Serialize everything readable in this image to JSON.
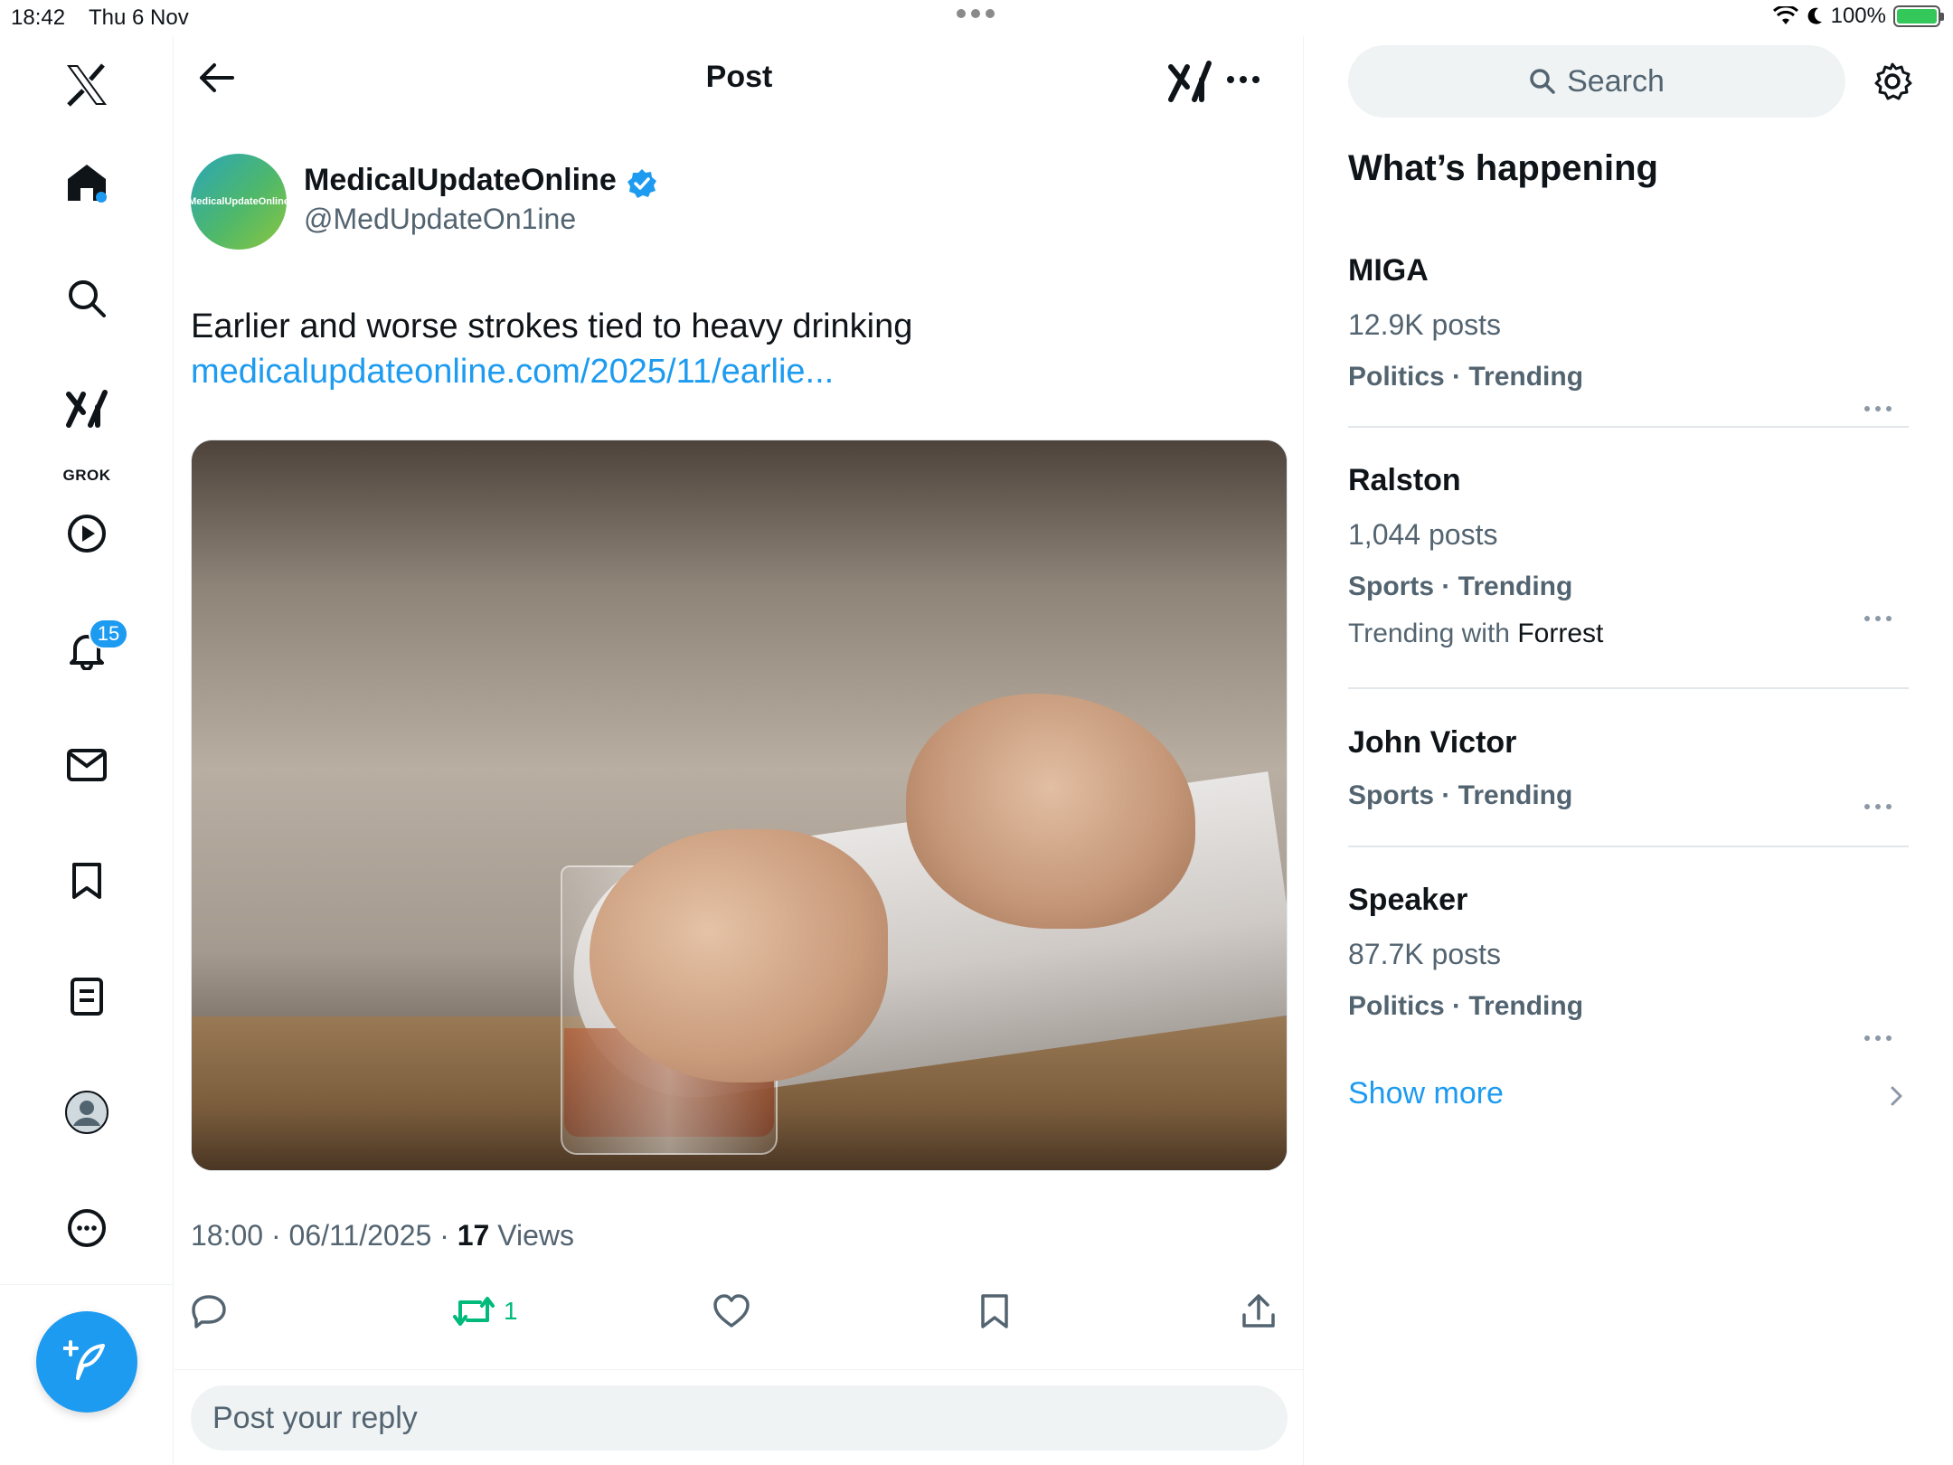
{
  "status_bar": {
    "time": "18:42",
    "date": "Thu 6 Nov",
    "battery": "100%"
  },
  "nav": {
    "notifications_badge": "15",
    "grok_label": "GROK"
  },
  "header": {
    "title": "Post"
  },
  "post": {
    "author_name": "MedicalUpdateOnline",
    "author_handle": "@MedUpdateOn1ine",
    "avatar_text": "MedicalUpdateOnline",
    "text": "Earlier and worse strokes tied to heavy drinking",
    "link": "medicalupdateonline.com/2025/11/earlie...",
    "time": "18:00",
    "date": "06/11/2025",
    "views_count": "17",
    "views_label": "Views",
    "retweet_count": "1"
  },
  "reply": {
    "placeholder": "Post your reply"
  },
  "sidebar": {
    "search_placeholder": "Search",
    "section_title": "What’s happening",
    "trends": [
      {
        "name": "MIGA",
        "count": "12.9K posts",
        "category": "Politics · Trending"
      },
      {
        "name": "Ralston",
        "count": "1,044 posts",
        "category": "Sports · Trending",
        "with_label": "Trending with",
        "with_name": "Forrest"
      },
      {
        "name": "John Victor",
        "category": "Sports · Trending"
      },
      {
        "name": "Speaker",
        "count": "87.7K posts",
        "category": "Politics · Trending"
      }
    ],
    "show_more": "Show more"
  },
  "colors": {
    "accent": "#1d9bf0",
    "retweet": "#00ba7c",
    "secondary_text": "#536471"
  }
}
